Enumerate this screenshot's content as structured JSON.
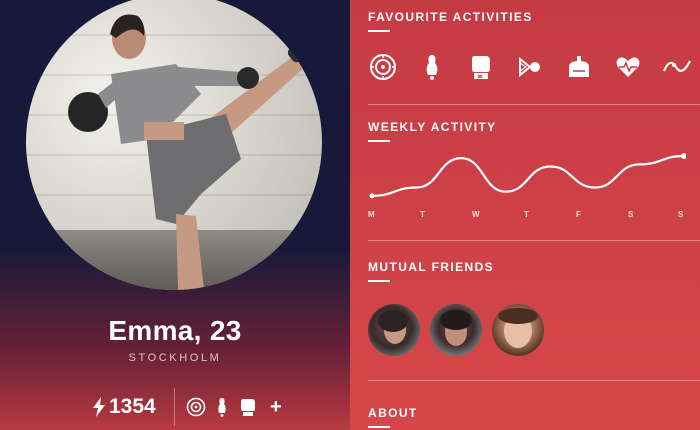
{
  "profile": {
    "name": "Emma, 23",
    "city": "STOCKHOLM",
    "score": "1354",
    "mini_icons": [
      "bike-wheel-icon",
      "bowling-icon",
      "boxing-glove-icon"
    ],
    "more_label": "+"
  },
  "sections": {
    "favourite_title": "FAVOURITE ACTIVITIES",
    "weekly_title": "WEEKLY ACTIVITY",
    "friends_title": "MUTUAL FRIENDS",
    "about_title": "ABOUT"
  },
  "favourite_activities": [
    "bike-wheel-icon",
    "bowling-icon",
    "boxing-glove-icon",
    "badminton-icon",
    "weight-scale-icon",
    "heart-rate-icon",
    "rollercoaster-icon"
  ],
  "weekly_days": [
    "M",
    "T",
    "W",
    "T",
    "F",
    "S",
    "S"
  ],
  "chart_data": {
    "type": "line",
    "categories": [
      "M",
      "T",
      "W",
      "T",
      "F",
      "S",
      "S"
    ],
    "values": [
      0.05,
      0.25,
      0.95,
      0.15,
      0.75,
      0.25,
      0.8,
      1.0
    ],
    "title": "WEEKLY ACTIVITY",
    "xlabel": "",
    "ylabel": "",
    "grid": false
  },
  "mutual_friends": [
    {
      "name": "friend-1"
    },
    {
      "name": "friend-2"
    },
    {
      "name": "friend-3"
    }
  ],
  "colors": {
    "left_bg": "#18193a",
    "right_bg": "#cf4247",
    "accent": "#ffffff"
  }
}
